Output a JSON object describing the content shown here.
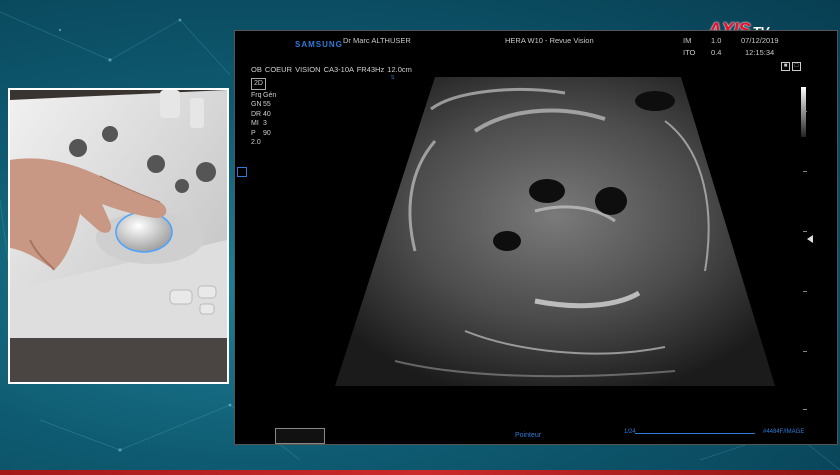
{
  "logo": {
    "main": "AXIS",
    "tv": "TV"
  },
  "ultrasound": {
    "brand": "SAMSUNG",
    "doctor": "Dr Marc ALTHUSER",
    "device": "HERA W10 - Revue Vision",
    "im_label": "IM",
    "im_value": "1.0",
    "date": "07/12/2019",
    "ito_label": "ITO",
    "ito_value": "0.4",
    "time": "12:15:34",
    "preset": "OB  COEUR VISION  CA3-10A  FR43Hz  12.0cm",
    "probe_marker": "S",
    "params": {
      "mode": "2D",
      "rows": [
        {
          "k": "Frq",
          "v": "Gén"
        },
        {
          "k": "GN",
          "v": "55"
        },
        {
          "k": "DR",
          "v": "40"
        },
        {
          "k": "MI",
          "v": "3"
        },
        {
          "k": "P",
          "v": "90"
        }
      ],
      "extra": "2.0"
    },
    "pointer_label": "Pointeur",
    "status_left": "1/24",
    "status_right": "#4484F/IMAGE"
  }
}
